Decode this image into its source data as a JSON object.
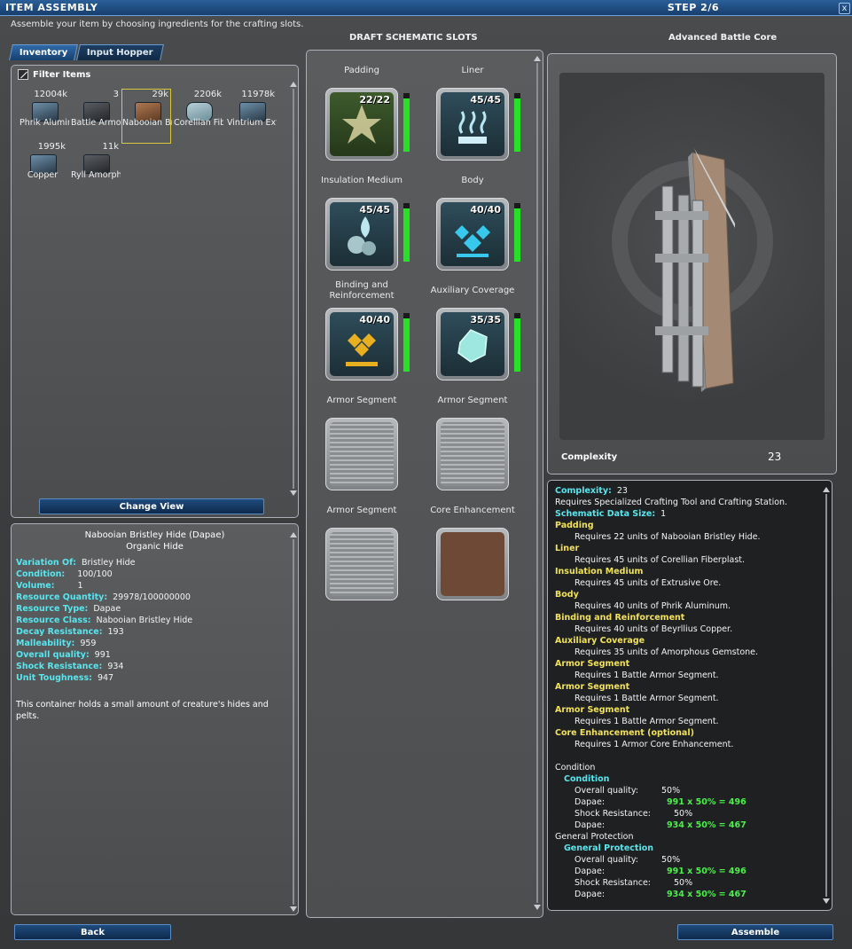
{
  "window": {
    "title": "ITEM ASSEMBLY",
    "step": "STEP 2/6",
    "close": "x",
    "subtitle": "Assemble your item by choosing ingredients for the crafting slots."
  },
  "tabs": [
    "Inventory",
    "Input Hopper"
  ],
  "filter_label": "Filter Items",
  "inventory": [
    {
      "qty": "12004k",
      "name": "Phrik Aluminu..."
    },
    {
      "qty": "3",
      "name": "Battle Armor Se..."
    },
    {
      "qty": "29k",
      "name": "Nabooian Bristley ..."
    },
    {
      "qty": "2206k",
      "name": "Corellian Fiberplas..."
    },
    {
      "qty": "11978k",
      "name": "Vintrium Extrusive..."
    },
    {
      "qty": "1995k",
      "name": "Copper"
    },
    {
      "qty": "11k",
      "name": "Ryll Amorpho..."
    }
  ],
  "change_view": "Change View",
  "details": {
    "title": "Nabooian Bristley Hide (Dapae)",
    "subtitle": "Organic Hide",
    "rows": [
      {
        "k": "Variation Of:",
        "v": "Bristley Hide"
      },
      {
        "k": "Condition:",
        "v": "100/100"
      },
      {
        "k": "Volume:",
        "v": "1"
      },
      {
        "k": "Resource Quantity:",
        "v": "29978/100000000"
      },
      {
        "k": "Resource Type:",
        "v": "Dapae"
      },
      {
        "k": "Resource Class:",
        "v": "Nabooian Bristley Hide"
      },
      {
        "k": "Decay Resistance:",
        "v": "193"
      },
      {
        "k": "Malleability:",
        "v": "959"
      },
      {
        "k": "Overall quality:",
        "v": "991"
      },
      {
        "k": "Shock Resistance:",
        "v": "934"
      },
      {
        "k": "Unit Toughness:",
        "v": "947"
      }
    ],
    "description": "This container holds a small amount of creature's hides and pelts."
  },
  "schematic": {
    "header": "DRAFT SCHEMATIC SLOTS",
    "slots": [
      {
        "label": "Padding",
        "count": "22/22",
        "fill": 1.0
      },
      {
        "label": "Liner",
        "count": "45/45",
        "fill": 1.0
      },
      {
        "label": "Insulation Medium",
        "count": "45/45",
        "fill": 1.0
      },
      {
        "label": "Body",
        "count": "40/40",
        "fill": 1.0
      },
      {
        "label": "Binding and Reinforcement",
        "count": "40/40",
        "fill": 1.0
      },
      {
        "label": "Auxiliary Coverage",
        "count": "35/35",
        "fill": 1.0
      },
      {
        "label": "Armor Segment",
        "count": ""
      },
      {
        "label": "Armor Segment",
        "count": ""
      },
      {
        "label": "Armor Segment",
        "count": ""
      },
      {
        "label": "Core Enhancement",
        "count": ""
      }
    ]
  },
  "preview": {
    "header": "Advanced Battle Core",
    "complexity_label": "Complexity",
    "complexity_value": "23"
  },
  "requirements": [
    {
      "cls": "c",
      "text": "Complexity:",
      "extra": "23"
    },
    {
      "cls": "w",
      "text": "Requires Specialized Crafting Tool and Crafting Station."
    },
    {
      "cls": "c",
      "text": "Schematic Data Size:",
      "extra": "1"
    },
    {
      "cls": "h",
      "text": "Padding"
    },
    {
      "cls": "w",
      "indent": true,
      "text": "Requires 22 units of Nabooian Bristley Hide."
    },
    {
      "cls": "h",
      "text": "Liner"
    },
    {
      "cls": "w",
      "indent": true,
      "text": "Requires 45 units of Corellian Fiberplast."
    },
    {
      "cls": "h",
      "text": "Insulation Medium"
    },
    {
      "cls": "w",
      "indent": true,
      "text": "Requires 45 units of Extrusive Ore."
    },
    {
      "cls": "h",
      "text": "Body"
    },
    {
      "cls": "w",
      "indent": true,
      "text": "Requires 40 units of Phrik Aluminum."
    },
    {
      "cls": "h",
      "text": "Binding and Reinforcement"
    },
    {
      "cls": "w",
      "indent": true,
      "text": "Requires 40 units of Beyrllius Copper."
    },
    {
      "cls": "h",
      "text": "Auxiliary Coverage"
    },
    {
      "cls": "w",
      "indent": true,
      "text": "Requires 35 units of Amorphous Gemstone."
    },
    {
      "cls": "h",
      "text": "Armor Segment"
    },
    {
      "cls": "w",
      "indent": true,
      "text": "Requires 1 Battle Armor Segment."
    },
    {
      "cls": "h",
      "text": "Armor Segment"
    },
    {
      "cls": "w",
      "indent": true,
      "text": "Requires 1 Battle Armor Segment."
    },
    {
      "cls": "h",
      "text": "Armor Segment"
    },
    {
      "cls": "w",
      "indent": true,
      "text": "Requires 1 Battle Armor Segment."
    },
    {
      "cls": "h",
      "text": "Core Enhancement (optional)"
    },
    {
      "cls": "w",
      "indent": true,
      "text": "Requires 1 Armor Core Enhancement."
    },
    {
      "cls": "w",
      "text": ""
    },
    {
      "cls": "w",
      "text": "Condition"
    },
    {
      "cls": "c",
      "indent1": true,
      "text": "Condition"
    },
    {
      "cls": "w",
      "indent": true,
      "text": "Overall quality:",
      "extra": "50%"
    },
    {
      "cls": "w",
      "indent": true,
      "text": "Dapae:",
      "g": "991 x 50% =  496"
    },
    {
      "cls": "w",
      "indent": true,
      "text": "Shock Resistance:",
      "extra": "50%"
    },
    {
      "cls": "w",
      "indent": true,
      "text": "Dapae:",
      "g": "934 x 50% =  467"
    },
    {
      "cls": "w",
      "text": "General Protection"
    },
    {
      "cls": "c",
      "indent1": true,
      "text": "General Protection"
    },
    {
      "cls": "w",
      "indent": true,
      "text": "Overall quality:",
      "extra": "50%"
    },
    {
      "cls": "w",
      "indent": true,
      "text": "Dapae:",
      "g": "991 x 50% =  496"
    },
    {
      "cls": "w",
      "indent": true,
      "text": "Shock Resistance:",
      "extra": "50%"
    },
    {
      "cls": "w",
      "indent": true,
      "text": "Dapae:",
      "g": "934 x 50% =  467"
    }
  ],
  "buttons": {
    "back": "Back",
    "assemble": "Assemble"
  }
}
